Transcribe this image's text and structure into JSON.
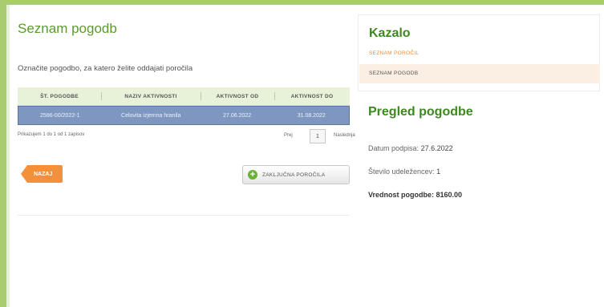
{
  "main": {
    "title": "Seznam pogodb",
    "instruction": "Označite pogodbo, za katero želite oddajati poročila",
    "table": {
      "headers": [
        "ŠT. POGODBE",
        "NAZIV AKTIVNOSTI",
        "AKTIVNOST OD",
        "AKTIVNOST DO"
      ],
      "rows": [
        [
          "2586-00/2022-1",
          "Celovita izjemna hranila",
          "27.06.2022",
          "31.08.2022"
        ]
      ]
    },
    "pager": {
      "info": "Prikazujem 1 do 1 od 1 zapisov",
      "prev": "Prej",
      "page": "1",
      "next": "Naslednja"
    },
    "back_label": "NAZAJ",
    "report_label": "ZAKLJUČNA POROČILA"
  },
  "side": {
    "index_title": "Kazalo",
    "index_items": [
      "SEZNAM POROČIL",
      "SEZNAM POGODB"
    ],
    "review_title": "Pregled pogodbe",
    "signing_label": "Datum podpisa:",
    "signing_value": "27.6.2022",
    "participants_label": "Število udeležencev:",
    "participants_value": "1",
    "value_label": "Vrednost pogodbe:",
    "value_value": "8160.00"
  },
  "colors": {
    "accent_green": "#3c8a1f",
    "frame_green": "#a9cd6e",
    "orange": "#f4903a",
    "selected_row": "#7d97c0"
  }
}
